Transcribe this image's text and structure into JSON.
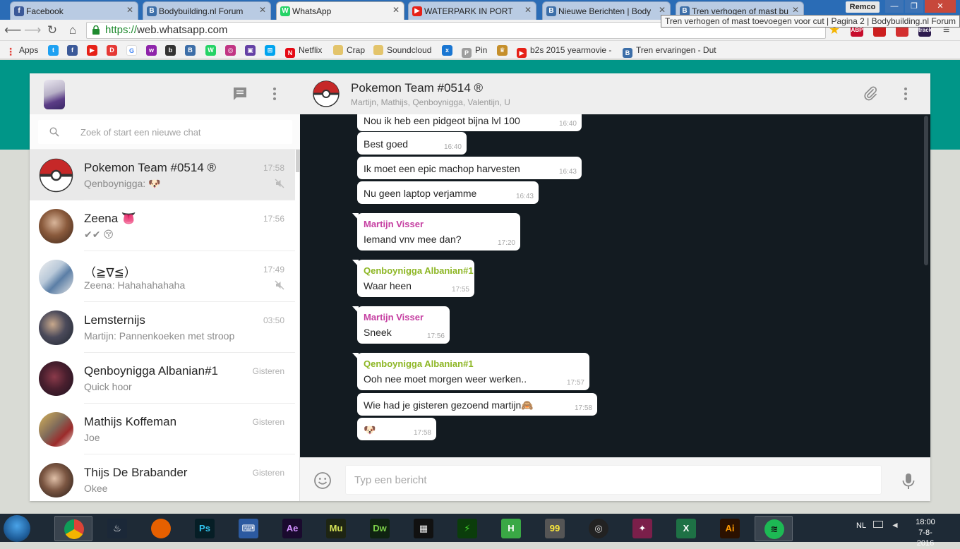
{
  "browser": {
    "tabs": [
      {
        "label": "Facebook",
        "icon": "facebook-icon",
        "color": "#3b5998",
        "glyph": "f"
      },
      {
        "label": "Bodybuilding.nl Forum",
        "icon": "bodybuilding-icon",
        "color": "#3c6ea8",
        "glyph": "B"
      },
      {
        "label": "WhatsApp",
        "icon": "whatsapp-icon",
        "color": "#25d366",
        "glyph": "W"
      },
      {
        "label": "WATERPARK IN PORT",
        "icon": "youtube-icon",
        "color": "#e62117",
        "glyph": "▶"
      },
      {
        "label": "Nieuwe Berichten | Body",
        "icon": "bodybuilding-icon",
        "color": "#3c6ea8",
        "glyph": "B"
      },
      {
        "label": "Tren verhogen of mast bu",
        "icon": "bodybuilding-icon",
        "color": "#3c6ea8",
        "glyph": "B"
      }
    ],
    "active_tab": 2,
    "window_user": "Remco",
    "url_scheme": "https://",
    "url_host": "web.whatsapp.com",
    "tooltip": "Tren verhogen of mast toevoegen voor cut | Pagina 2 | Bodybuilding.nl Forum",
    "extensions": [
      {
        "icon": "adblock-icon",
        "label": "ABP",
        "color": "#c70d2c"
      },
      {
        "icon": "youtube-ext-icon",
        "label": "",
        "color": "#cc1f1f"
      },
      {
        "icon": "ext-icon",
        "label": "",
        "color": "#d32f2f"
      },
      {
        "icon": "track-icon",
        "label": "track",
        "color": "#2d1b4e"
      }
    ],
    "bookmarks": [
      {
        "label": "Apps",
        "icon": "apps-icon",
        "color": "#4a86e8",
        "glyph": "⋮"
      },
      {
        "label": "",
        "icon": "twitter-icon",
        "color": "#1da1f2",
        "glyph": "t"
      },
      {
        "label": "",
        "icon": "facebook-icon",
        "color": "#3b5998",
        "glyph": "f"
      },
      {
        "label": "",
        "icon": "youtube-icon",
        "color": "#e62117",
        "glyph": "▶"
      },
      {
        "label": "",
        "icon": "d-icon",
        "color": "#e53935",
        "glyph": "D"
      },
      {
        "label": "",
        "icon": "google-icon",
        "color": "#ffffff",
        "glyph": "G"
      },
      {
        "label": "",
        "icon": "w-icon",
        "color": "#8e24aa",
        "glyph": "w"
      },
      {
        "label": "",
        "icon": "b-icon",
        "color": "#333333",
        "glyph": "b"
      },
      {
        "label": "",
        "icon": "bodybuilding-icon",
        "color": "#3c6ea8",
        "glyph": "B"
      },
      {
        "label": "",
        "icon": "whatsapp-icon",
        "color": "#25d366",
        "glyph": "W"
      },
      {
        "label": "",
        "icon": "instagram-icon",
        "color": "#c13584",
        "glyph": "◎"
      },
      {
        "label": "",
        "icon": "twitch-icon",
        "color": "#6441a5",
        "glyph": "▣"
      },
      {
        "label": "",
        "icon": "windows-icon",
        "color": "#00a4ef",
        "glyph": "⊞"
      },
      {
        "label": "Netflix",
        "icon": "netflix-icon",
        "color": "#e50914",
        "glyph": "N"
      },
      {
        "label": "Crap",
        "icon": "folder-icon",
        "color": "#e3c46b",
        "glyph": ""
      },
      {
        "label": "Soundcloud",
        "icon": "folder-icon",
        "color": "#e3c46b",
        "glyph": ""
      },
      {
        "label": "",
        "icon": "x-icon",
        "color": "#1976d2",
        "glyph": "x"
      },
      {
        "label": "Pin",
        "icon": "pin-icon",
        "color": "#9e9e9e",
        "glyph": "P"
      },
      {
        "label": "",
        "icon": "crown-icon",
        "color": "#c58f2b",
        "glyph": "♛"
      },
      {
        "label": "b2s 2015 yearmovie -",
        "icon": "youtube-icon",
        "color": "#e62117",
        "glyph": "▶"
      },
      {
        "label": "Tren ervaringen - Dut",
        "icon": "bodybuilding-icon",
        "color": "#3c6ea8",
        "glyph": "B"
      }
    ]
  },
  "whatsapp": {
    "search_placeholder": "Zoek of start een nieuwe chat",
    "chats": [
      {
        "name": "Pokemon Team #0514 ®",
        "time": "17:58",
        "message": "Qenboynigga: 🐶",
        "muted": true,
        "selected": true,
        "avatar": "pokeball"
      },
      {
        "name": "Zeena 👅",
        "time": "17:56",
        "message": "✔✔ 😚",
        "muted": false,
        "selected": false,
        "avatar": "photo-a"
      },
      {
        "name": "（≧∇≦）",
        "time": "17:49",
        "message": "Zeena: Hahahahahaha",
        "muted": true,
        "selected": false,
        "avatar": "photo-b"
      },
      {
        "name": "Lemsternijs",
        "time": "03:50",
        "message": "Martijn: Pannenkoeken met stroop",
        "muted": false,
        "selected": false,
        "avatar": "photo-c"
      },
      {
        "name": "Qenboynigga Albanian#1",
        "time": "Gisteren",
        "message": "Quick hoor",
        "muted": false,
        "selected": false,
        "avatar": "photo-d"
      },
      {
        "name": "Mathijs Koffeman",
        "time": "Gisteren",
        "message": "Joe",
        "muted": false,
        "selected": false,
        "avatar": "photo-e"
      },
      {
        "name": "Thijs De Brabander",
        "time": "Gisteren",
        "message": "Okee",
        "muted": false,
        "selected": false,
        "avatar": "photo-f"
      }
    ],
    "conversation": {
      "title": "Pokemon Team #0514 ®",
      "members": "Martijn, Mathijs, Qenboynigga, Valentijn, U",
      "messages": [
        {
          "sender": "",
          "text": "Nou ik heb een pidgeot bijna lvl 100",
          "time": "16:40"
        },
        {
          "sender": "",
          "text": "Best goed",
          "time": "16:40"
        },
        {
          "sender": "",
          "text": "Ik moet een epic machop harvesten",
          "time": "16:43"
        },
        {
          "sender": "",
          "text": "Nu geen laptop verjamme",
          "time": "16:43"
        },
        {
          "sender": "Martijn Visser",
          "sender_color": "#c53ea1",
          "text": "Iemand vnv mee dan?",
          "time": "17:20"
        },
        {
          "sender": "Qenboynigga Albanian#1",
          "sender_color": "#8db624",
          "text": "Waar heen",
          "time": "17:55"
        },
        {
          "sender": "Martijn Visser",
          "sender_color": "#c53ea1",
          "text": "Sneek",
          "time": "17:56"
        },
        {
          "sender": "Qenboynigga Albanian#1",
          "sender_color": "#8db624",
          "text": "Ooh nee moet morgen weer werken..",
          "time": "17:57"
        },
        {
          "sender": "",
          "text": "Wie had je gisteren gezoend martijn🙈",
          "time": "17:58"
        },
        {
          "sender": "",
          "text": "🐶",
          "time": "17:58"
        }
      ]
    },
    "compose_placeholder": "Typ een bericht"
  },
  "taskbar": {
    "apps": [
      {
        "name": "chrome",
        "icon": "chrome-icon",
        "label": "",
        "color": "#4caf50",
        "text_color": "#fff",
        "pinned": true
      },
      {
        "name": "steam",
        "icon": "steam-icon",
        "label": "♨",
        "color": "#1b2838",
        "text_color": "#fff",
        "pinned": false
      },
      {
        "name": "firefox",
        "icon": "firefox-icon",
        "label": "",
        "color": "#e66000",
        "text_color": "#fff",
        "pinned": false
      },
      {
        "name": "photoshop",
        "icon": "photoshop-icon",
        "label": "Ps",
        "color": "#061e26",
        "text_color": "#31c5f0",
        "pinned": false
      },
      {
        "name": "keyboard",
        "icon": "keyboard-icon",
        "label": "⌨",
        "color": "#2c5aa0",
        "text_color": "#fff",
        "pinned": false
      },
      {
        "name": "aftereffects",
        "icon": "after-effects-icon",
        "label": "Ae",
        "color": "#1a0a2e",
        "text_color": "#d291ff",
        "pinned": false
      },
      {
        "name": "muse",
        "icon": "muse-icon",
        "label": "Mu",
        "color": "#1e2513",
        "text_color": "#d4e157",
        "pinned": false
      },
      {
        "name": "dreamweaver",
        "icon": "dreamweaver-icon",
        "label": "Dw",
        "color": "#0f2311",
        "text_color": "#7cd14a",
        "pinned": false
      },
      {
        "name": "video",
        "icon": "film-icon",
        "label": "▦",
        "color": "#111",
        "text_color": "#eee",
        "pinned": false
      },
      {
        "name": "razer",
        "icon": "razer-icon",
        "label": "⚡",
        "color": "#0b3d0b",
        "text_color": "#44d62c",
        "pinned": false
      },
      {
        "name": "hotspot",
        "icon": "hotspot-shield-icon",
        "label": "H",
        "color": "#3aa845",
        "text_color": "#fff",
        "pinned": false
      },
      {
        "name": "monitor",
        "icon": "monitor-icon",
        "label": "99",
        "color": "#555",
        "text_color": "#ffeb3b",
        "pinned": false
      },
      {
        "name": "ccleaner",
        "icon": "ccleaner-icon",
        "label": "◎",
        "color": "#222",
        "text_color": "#ddd",
        "pinned": false
      },
      {
        "name": "game",
        "icon": "game-icon",
        "label": "✦",
        "color": "#7b1f4a",
        "text_color": "#fff",
        "pinned": false
      },
      {
        "name": "excel",
        "icon": "excel-icon",
        "label": "X",
        "color": "#1e7145",
        "text_color": "#fff",
        "pinned": false
      },
      {
        "name": "illustrator",
        "icon": "illustrator-icon",
        "label": "Ai",
        "color": "#2b1100",
        "text_color": "#ff9a00",
        "pinned": false
      },
      {
        "name": "spotify",
        "icon": "spotify-icon",
        "label": "≋",
        "color": "#1db954",
        "text_color": "#111",
        "pinned": true
      }
    ],
    "language": "NL",
    "time": "18:00",
    "date": "7-8-2016"
  },
  "colors": {
    "teal": "#009688",
    "chat_bg": "#131b21",
    "selected_chat": "#e9e9e9"
  }
}
